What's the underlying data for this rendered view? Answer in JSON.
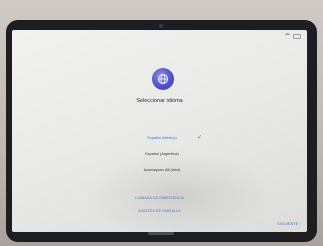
{
  "setup": {
    "title": "Seleccionar idioma",
    "languages": [
      {
        "label": "Español (México)",
        "selected": true
      },
      {
        "label": "Español (Argentina)",
        "selected": false
      },
      {
        "label": "Azərbaycan dili (latın)",
        "selected": false
      }
    ],
    "links": {
      "emergency": "LLAMADA DE EMERGENCIA",
      "accessibility": "AJUSTES DE PANTALLA"
    },
    "next_label": "SIGUIENTE ›"
  },
  "icons": {
    "language": "globe-icon",
    "selected_mark": "check-icon"
  },
  "colors": {
    "accent": "#3b6ecf",
    "globe": "#4f51c9",
    "screen_bg": "#eceeed",
    "bezel": "#1d1e22"
  }
}
